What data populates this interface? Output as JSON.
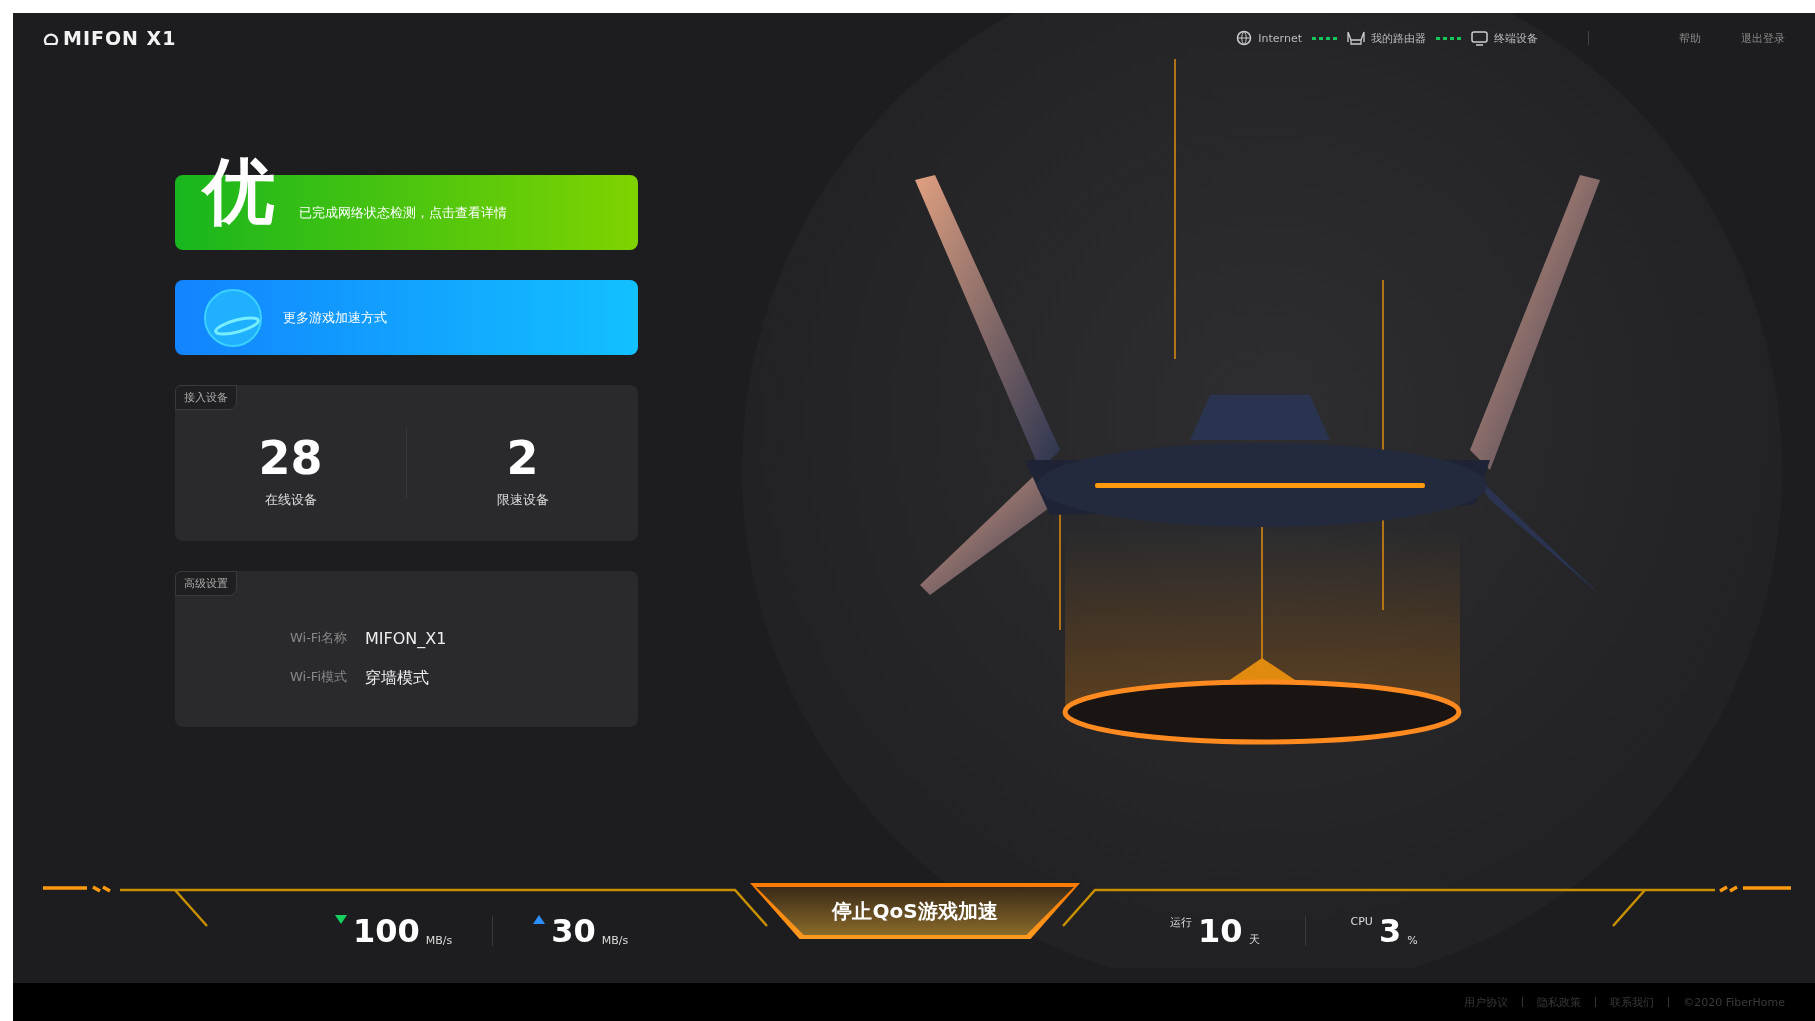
{
  "header": {
    "logo": "MIFON X1",
    "topology": [
      {
        "label": "Internet",
        "kind": "globe"
      },
      {
        "label": "我的路由器",
        "kind": "router"
      },
      {
        "label": "终端设备",
        "kind": "monitor"
      }
    ],
    "links": [
      "帮助",
      "退出登录"
    ]
  },
  "status_card": {
    "grade": "优",
    "text": "已完成网络状态检测，点击查看详情"
  },
  "boost_card": {
    "text": "更多游戏加速方式"
  },
  "devices": {
    "title": "接入设备",
    "stats": [
      {
        "value": "28",
        "label": "在线设备"
      },
      {
        "value": "2",
        "label": "限速设备"
      }
    ]
  },
  "settings": {
    "title": "高级设置",
    "rows": [
      {
        "label": "Wi-Fi名称",
        "value": "MIFON_X1"
      },
      {
        "label": "Wi-Fi模式",
        "value": "穿墙模式"
      }
    ]
  },
  "traffic": [
    {
      "kind": "download",
      "value": "100",
      "unit": "MB/s"
    },
    {
      "kind": "upload",
      "value": "30",
      "unit": "MB/s"
    }
  ],
  "action_button": "停止QoS游戏加速",
  "system": [
    {
      "label": "运行",
      "value": "10",
      "unit": "天"
    },
    {
      "label": "CPU",
      "value": "3",
      "unit": "%"
    }
  ],
  "footer": [
    "用户协议",
    "隐私政策",
    "联系我们",
    "©2020 FiberHome"
  ]
}
